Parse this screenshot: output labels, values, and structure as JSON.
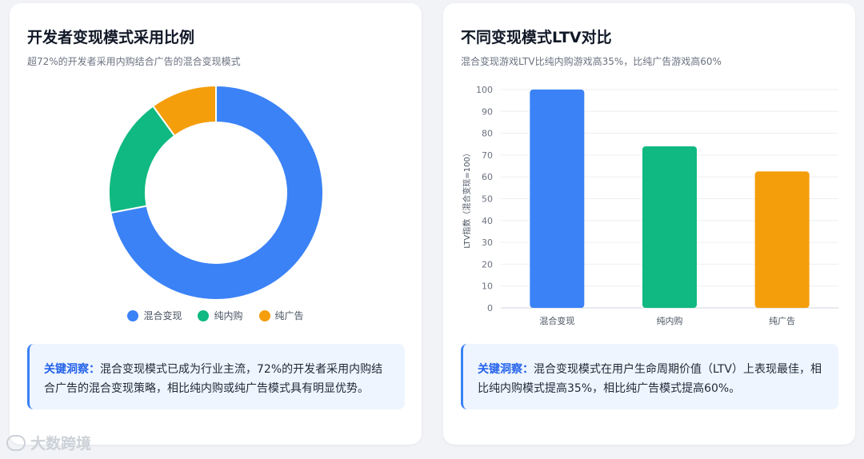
{
  "left": {
    "title": "开发者变现模式采用比例",
    "subtitle": "超72%的开发者采用内购结合广告的混合变现模式",
    "insight_label": "关键洞察：",
    "insight_text": "混合变现模式已成为行业主流，72%的开发者采用内购结合广告的混合变现策略，相比纯内购或纯广告模式具有明显优势。"
  },
  "right": {
    "title": "不同变现模式LTV对比",
    "subtitle": "混合变现游戏LTV比纯内购游戏高35%，比纯广告游戏高60%",
    "insight_label": "关键洞察：",
    "insight_text": "混合变现模式在用户生命周期价值（LTV）上表现最佳，相比纯内购模式提高35%，相比纯广告模式提高60%。"
  },
  "watermark": "大数跨境",
  "chart_data": [
    {
      "type": "pie",
      "donut": true,
      "categories": [
        "混合变现",
        "纯内购",
        "纯广告"
      ],
      "values": [
        72,
        18,
        10
      ],
      "colors": [
        "#3b82f6",
        "#10b981",
        "#f59e0b"
      ],
      "legend_position": "bottom"
    },
    {
      "type": "bar",
      "categories": [
        "混合变现",
        "纯内购",
        "纯广告"
      ],
      "values": [
        100,
        74,
        62.5
      ],
      "colors": [
        "#3b82f6",
        "#10b981",
        "#f59e0b"
      ],
      "ylabel": "LTV指数（混合变现=100）",
      "ylim": [
        0,
        100
      ],
      "yticks": [
        0,
        10,
        20,
        30,
        40,
        50,
        60,
        70,
        80,
        90,
        100
      ],
      "grid": true
    }
  ]
}
